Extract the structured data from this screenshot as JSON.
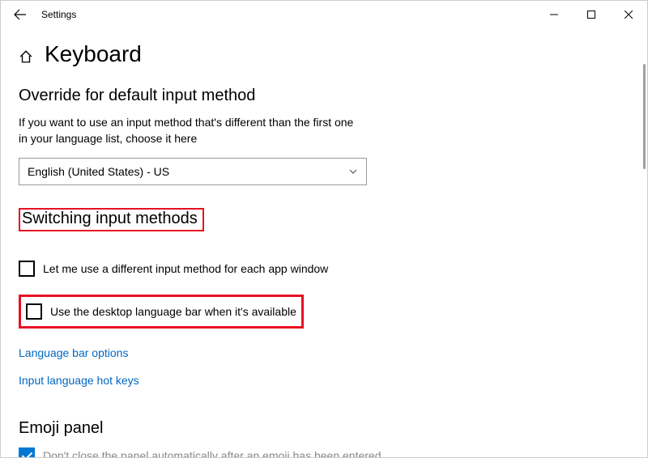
{
  "window": {
    "title": "Settings"
  },
  "page": {
    "title": "Keyboard"
  },
  "section_override": {
    "heading": "Override for default input method",
    "description": "If you want to use an input method that's different than the first one in your language list, choose it here",
    "dropdown_value": "English (United States) - US"
  },
  "section_switching": {
    "heading": "Switching input methods",
    "checkbox1_label": "Let me use a different input method for each app window",
    "checkbox2_label": "Use the desktop language bar when it's available",
    "link1": "Language bar options",
    "link2": "Input language hot keys"
  },
  "section_emoji": {
    "heading": "Emoji panel",
    "checkbox_label": "Don't close the panel automatically after an emoji has been entered"
  }
}
